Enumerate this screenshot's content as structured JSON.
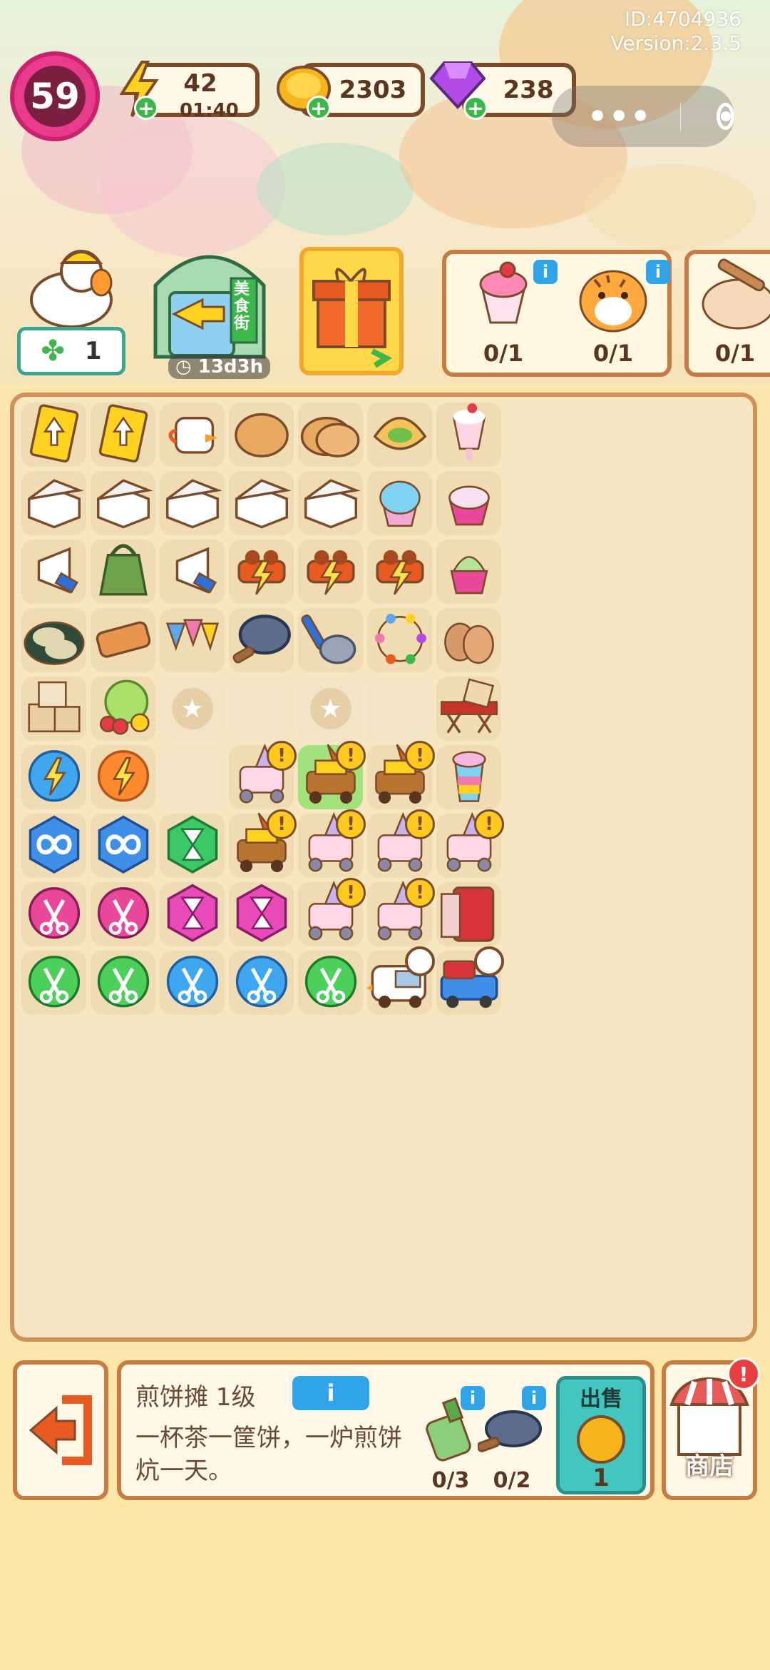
{
  "meta": {
    "id": "ID:4704936",
    "version": "Version:2.3.5"
  },
  "header": {
    "level": "59",
    "energy": {
      "value": "42",
      "timer": "01:40"
    },
    "coins": "2303",
    "gems": "238"
  },
  "quest": {
    "clover_count": "1",
    "shop_timer": "13d3h",
    "sign_text": "美食街"
  },
  "orders": [
    {
      "name": "shaved-ice-sundae",
      "count": "0/1"
    },
    {
      "name": "tiger-plush",
      "count": "0/1"
    },
    {
      "name": "bun",
      "count": "0/1"
    }
  ],
  "board": {
    "rows": [
      [
        "ticket-up",
        "ticket-up",
        "duck-mug",
        "pancake",
        "pancake-stack",
        "crepe-wrap",
        "parfait"
      ],
      [
        "takeout-box",
        "takeout-box",
        "takeout-box",
        "takeout-box",
        "takeout-box",
        "shaved-ice",
        "ice-cream-cup"
      ],
      [
        "megaphone",
        "apron",
        "megaphone",
        "grill-charged",
        "grill-charged",
        "grill-charged",
        "matcha-ice-cream"
      ],
      [
        "oyster-plate",
        "skewers",
        "bunting",
        "frying-pan",
        "ladle",
        "string-lights",
        "eggs"
      ],
      [
        "boxes",
        "melon-cherry",
        "locked",
        "empty",
        "locked",
        "empty",
        "camp-table"
      ],
      [
        "energy-orb-blue",
        "energy-orb-orange",
        "empty",
        "crepe-cart",
        "oden-cart",
        "oden-cart",
        "rainbow-drink"
      ],
      [
        "infinity-hex-blue",
        "infinity-hex-blue",
        "hourglass-hex-green",
        "oden-cart",
        "crepe-cart",
        "crepe-cart",
        "crepe-cart"
      ],
      [
        "scissors-pink",
        "scissors-pink",
        "hourglass-hex-pink",
        "hourglass-hex-pink",
        "crepe-cart",
        "crepe-cart",
        "fridge"
      ],
      [
        "scissors-green",
        "scissors-green",
        "scissors-blue",
        "scissors-blue",
        "scissors-green",
        "duck-van",
        "pickup-truck"
      ]
    ]
  },
  "panel": {
    "title": "煎饼摊 1级",
    "info_label": "i",
    "description": "一杯茶一筐饼，一炉煎饼炕一天。",
    "requirements": [
      {
        "name": "bottle",
        "count": "0/3"
      },
      {
        "name": "frying-pan",
        "count": "0/2"
      }
    ],
    "sell_label": "出售",
    "sell_value": "1",
    "shop_label": "商店",
    "shop_badge": "!"
  },
  "colors": {
    "accent": "#c97b45",
    "board_bg": "#f6e6c2",
    "sell_bg": "#43c6c0",
    "level_bg": "#e83b8b"
  }
}
